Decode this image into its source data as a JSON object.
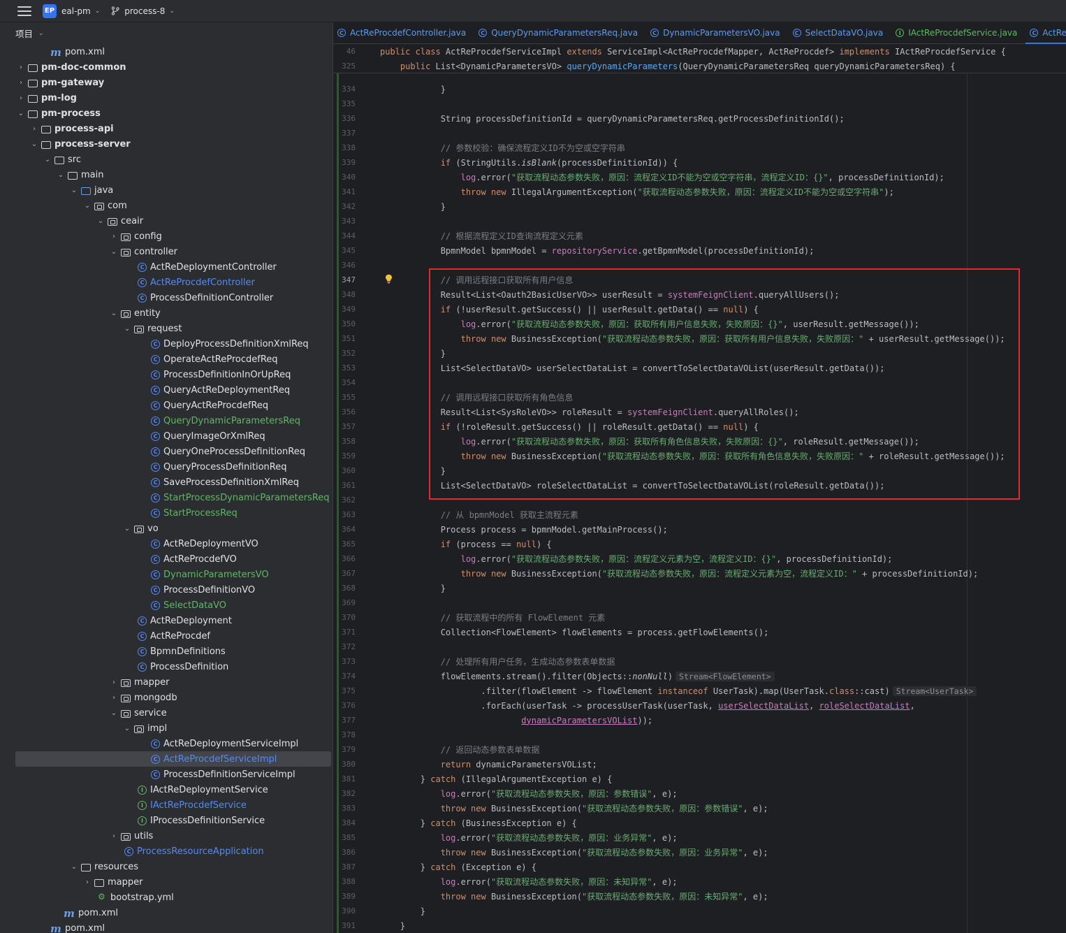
{
  "topbar": {
    "badge": "EP",
    "project_name": "eal-pm",
    "branch": "process-8"
  },
  "project_panel": {
    "title": "项目",
    "tree": [
      {
        "label": "pom.xml",
        "kind": "maven",
        "indent": 62,
        "arrow": "",
        "style": "white"
      },
      {
        "label": "pm-doc-common",
        "kind": "module",
        "indent": 30,
        "arrow": "›",
        "style": "bold"
      },
      {
        "label": "pm-gateway",
        "kind": "module",
        "indent": 30,
        "arrow": "›",
        "style": "bold"
      },
      {
        "label": "pm-log",
        "kind": "module",
        "indent": 30,
        "arrow": "›",
        "style": "bold"
      },
      {
        "label": "pm-process",
        "kind": "module",
        "indent": 30,
        "arrow": "⌄",
        "style": "bold"
      },
      {
        "label": "process-api",
        "kind": "module",
        "indent": 49,
        "arrow": "›",
        "style": "bold"
      },
      {
        "label": "process-server",
        "kind": "module",
        "indent": 49,
        "arrow": "⌄",
        "style": "bold"
      },
      {
        "label": "src",
        "kind": "folder",
        "indent": 68,
        "arrow": "⌄",
        "style": "white"
      },
      {
        "label": "main",
        "kind": "folder",
        "indent": 87,
        "arrow": "⌄",
        "style": "white"
      },
      {
        "label": "java",
        "kind": "src",
        "indent": 106,
        "arrow": "⌄",
        "style": "white"
      },
      {
        "label": "com",
        "kind": "pkg",
        "indent": 125,
        "arrow": "⌄",
        "style": "white"
      },
      {
        "label": "ceair",
        "kind": "pkg",
        "indent": 144,
        "arrow": "⌄",
        "style": "white"
      },
      {
        "label": "config",
        "kind": "pkg",
        "indent": 163,
        "arrow": "›",
        "style": "white"
      },
      {
        "label": "controller",
        "kind": "pkg",
        "indent": 163,
        "arrow": "⌄",
        "style": "white"
      },
      {
        "label": "ActReDeploymentController",
        "kind": "class",
        "indent": 187,
        "arrow": "",
        "style": "white"
      },
      {
        "label": "ActReProcdefController",
        "kind": "class",
        "indent": 187,
        "arrow": "",
        "style": "blue"
      },
      {
        "label": "ProcessDefinitionController",
        "kind": "class",
        "indent": 187,
        "arrow": "",
        "style": "white"
      },
      {
        "label": "entity",
        "kind": "pkg",
        "indent": 163,
        "arrow": "⌄",
        "style": "white"
      },
      {
        "label": "request",
        "kind": "pkg",
        "indent": 182,
        "arrow": "⌄",
        "style": "white"
      },
      {
        "label": "DeployProcessDefinitionXmlReq",
        "kind": "class",
        "indent": 206,
        "arrow": "",
        "style": "white"
      },
      {
        "label": "OperateActReProcdefReq",
        "kind": "class",
        "indent": 206,
        "arrow": "",
        "style": "white"
      },
      {
        "label": "ProcessDefinitionInOrUpReq",
        "kind": "class",
        "indent": 206,
        "arrow": "",
        "style": "white"
      },
      {
        "label": "QueryActReDeploymentReq",
        "kind": "class",
        "indent": 206,
        "arrow": "",
        "style": "white"
      },
      {
        "label": "QueryActReProcdefReq",
        "kind": "class",
        "indent": 206,
        "arrow": "",
        "style": "white"
      },
      {
        "label": "QueryDynamicParametersReq",
        "kind": "class",
        "indent": 206,
        "arrow": "",
        "style": "green"
      },
      {
        "label": "QueryImageOrXmlReq",
        "kind": "class",
        "indent": 206,
        "arrow": "",
        "style": "white"
      },
      {
        "label": "QueryOneProcessDefinitionReq",
        "kind": "class",
        "indent": 206,
        "arrow": "",
        "style": "white"
      },
      {
        "label": "QueryProcessDefinitionReq",
        "kind": "class",
        "indent": 206,
        "arrow": "",
        "style": "white"
      },
      {
        "label": "SaveProcessDefinitionXmlReq",
        "kind": "class",
        "indent": 206,
        "arrow": "",
        "style": "white"
      },
      {
        "label": "StartProcessDynamicParametersReq",
        "kind": "class",
        "indent": 206,
        "arrow": "",
        "style": "green"
      },
      {
        "label": "StartProcessReq",
        "kind": "class",
        "indent": 206,
        "arrow": "",
        "style": "green"
      },
      {
        "label": "vo",
        "kind": "pkg",
        "indent": 182,
        "arrow": "⌄",
        "style": "white"
      },
      {
        "label": "ActReDeploymentVO",
        "kind": "class",
        "indent": 206,
        "arrow": "",
        "style": "white"
      },
      {
        "label": "ActReProcdefVO",
        "kind": "class",
        "indent": 206,
        "arrow": "",
        "style": "white"
      },
      {
        "label": "DynamicParametersVO",
        "kind": "class",
        "indent": 206,
        "arrow": "",
        "style": "green"
      },
      {
        "label": "ProcessDefinitionVO",
        "kind": "class",
        "indent": 206,
        "arrow": "",
        "style": "white"
      },
      {
        "label": "SelectDataVO",
        "kind": "class",
        "indent": 206,
        "arrow": "",
        "style": "green"
      },
      {
        "label": "ActReDeployment",
        "kind": "class",
        "indent": 187,
        "arrow": "",
        "style": "white"
      },
      {
        "label": "ActReProcdef",
        "kind": "class",
        "indent": 187,
        "arrow": "",
        "style": "white"
      },
      {
        "label": "BpmnDefinitions",
        "kind": "class",
        "indent": 187,
        "arrow": "",
        "style": "white"
      },
      {
        "label": "ProcessDefinition",
        "kind": "class",
        "indent": 187,
        "arrow": "",
        "style": "white"
      },
      {
        "label": "mapper",
        "kind": "pkg",
        "indent": 163,
        "arrow": "›",
        "style": "white"
      },
      {
        "label": "mongodb",
        "kind": "pkg",
        "indent": 163,
        "arrow": "›",
        "style": "white"
      },
      {
        "label": "service",
        "kind": "pkg",
        "indent": 163,
        "arrow": "⌄",
        "style": "white"
      },
      {
        "label": "impl",
        "kind": "pkg",
        "indent": 182,
        "arrow": "⌄",
        "style": "white"
      },
      {
        "label": "ActReDeploymentServiceImpl",
        "kind": "class",
        "indent": 206,
        "arrow": "",
        "style": "white"
      },
      {
        "label": "ActReProcdefServiceImpl",
        "kind": "class",
        "indent": 206,
        "arrow": "",
        "style": "blue",
        "selected": true
      },
      {
        "label": "ProcessDefinitionServiceImpl",
        "kind": "class",
        "indent": 206,
        "arrow": "",
        "style": "white"
      },
      {
        "label": "IActReDeploymentService",
        "kind": "intf",
        "indent": 187,
        "arrow": "",
        "style": "white"
      },
      {
        "label": "IActReProcdefService",
        "kind": "intf",
        "indent": 187,
        "arrow": "",
        "style": "blue"
      },
      {
        "label": "IProcessDefinitionService",
        "kind": "intf",
        "indent": 187,
        "arrow": "",
        "style": "white"
      },
      {
        "label": "utils",
        "kind": "pkg",
        "indent": 163,
        "arrow": "›",
        "style": "white"
      },
      {
        "label": "ProcessResourceApplication",
        "kind": "class",
        "indent": 168,
        "arrow": "",
        "style": "blue"
      },
      {
        "label": "resources",
        "kind": "folder",
        "indent": 106,
        "arrow": "⌄",
        "style": "white"
      },
      {
        "label": "mapper",
        "kind": "folder",
        "indent": 125,
        "arrow": "›",
        "style": "white"
      },
      {
        "label": "bootstrap.yml",
        "kind": "yml",
        "indent": 130,
        "arrow": "",
        "style": "white"
      },
      {
        "label": "pom.xml",
        "kind": "maven",
        "indent": 81,
        "arrow": "",
        "style": "white"
      },
      {
        "label": "pom.xml",
        "kind": "maven",
        "indent": 62,
        "arrow": "",
        "style": "white"
      }
    ]
  },
  "tabs": [
    {
      "label": "ActReProcdefController.java",
      "kind": "class",
      "active": false
    },
    {
      "label": "QueryDynamicParametersReq.java",
      "kind": "class",
      "active": false
    },
    {
      "label": "DynamicParametersVO.java",
      "kind": "class",
      "active": false
    },
    {
      "label": "SelectDataVO.java",
      "kind": "class",
      "active": false
    },
    {
      "label": "IActReProcdefService.java",
      "kind": "intf",
      "active": false
    },
    {
      "label": "ActReProcdefServi",
      "kind": "class",
      "active": true
    }
  ],
  "sticky_lines": [
    {
      "num": "46",
      "html": "<span class=\"kw\">public class</span> ActReProcdefServiceImpl <span class=\"kw\">extends</span> ServiceImpl&lt;ActReProcdefMapper, ActReProcdef&gt; <span class=\"kw\">implements</span> IActReProcdefService {"
    },
    {
      "num": "325",
      "html": "    <span class=\"kw\">public</span> List&lt;DynamicParametersVO&gt; <span class=\"fn\">queryDynamicParameters</span>(QueryDynamicParametersReq queryDynamicParametersReq) {"
    }
  ],
  "code_lines": [
    {
      "num": "334",
      "html": "            }"
    },
    {
      "num": "335",
      "html": ""
    },
    {
      "num": "336",
      "html": "            String processDefinitionId = queryDynamicParametersReq.getProcessDefinitionId();"
    },
    {
      "num": "337",
      "html": ""
    },
    {
      "num": "338",
      "html": "            <span class=\"cm\">// 参数校验：确保流程定义ID不为空或空字符串</span>"
    },
    {
      "num": "339",
      "html": "            <span class=\"kw\">if</span> (StringUtils.<span class=\"ital\">isBlank</span>(processDefinitionId)) {"
    },
    {
      "num": "340",
      "html": "                <span class=\"fld\">log</span>.error(<span class=\"st\">\"获取流程动态参数失败，原因：流程定义ID不能为空或空字符串，流程定义ID：{}\"</span>, processDefinitionId);"
    },
    {
      "num": "341",
      "html": "                <span class=\"kw\">throw new</span> IllegalArgumentException(<span class=\"st\">\"获取流程动态参数失败，原因：流程定义ID不能为空或空字符串\"</span>);"
    },
    {
      "num": "342",
      "html": "            }"
    },
    {
      "num": "343",
      "html": ""
    },
    {
      "num": "344",
      "html": "            <span class=\"cm\">// 根据流程定义ID查询流程定义元素</span>"
    },
    {
      "num": "345",
      "html": "            BpmnModel bpmnModel = <span class=\"fld\">repositoryService</span>.getBpmnModel(processDefinitionId);"
    },
    {
      "num": "346",
      "html": ""
    },
    {
      "num": "347",
      "html": "            <span class=\"cm\">// 调用远程接口获取所有用户信息</span>",
      "current": true
    },
    {
      "num": "348",
      "html": "            Result&lt;List&lt;Oauth2BasicUserVO&gt;&gt; userResult = <span class=\"fld\">systemFeignClient</span>.queryAllUsers();"
    },
    {
      "num": "349",
      "html": "            <span class=\"kw\">if</span> (!userResult.getSuccess() || userResult.getData() == <span class=\"kw\">null</span>) {"
    },
    {
      "num": "350",
      "html": "                <span class=\"fld\">log</span>.error(<span class=\"st\">\"获取流程动态参数失败，原因：获取所有用户信息失败，失败原因：{}\"</span>, userResult.getMessage());"
    },
    {
      "num": "351",
      "html": "                <span class=\"kw\">throw new</span> BusinessException(<span class=\"st\">\"获取流程动态参数失败，原因：获取所有用户信息失败，失败原因：\"</span> + userResult.getMessage());"
    },
    {
      "num": "352",
      "html": "            }"
    },
    {
      "num": "353",
      "html": "            List&lt;SelectDataVO&gt; userSelectDataList = convertToSelectDataVOList(userResult.getData());"
    },
    {
      "num": "354",
      "html": ""
    },
    {
      "num": "355",
      "html": "            <span class=\"cm\">// 调用远程接口获取所有角色信息</span>"
    },
    {
      "num": "356",
      "html": "            Result&lt;List&lt;SysRoleVO&gt;&gt; roleResult = <span class=\"fld\">systemFeignClient</span>.queryAllRoles();"
    },
    {
      "num": "357",
      "html": "            <span class=\"kw\">if</span> (!roleResult.getSuccess() || roleResult.getData() == <span class=\"kw\">null</span>) {"
    },
    {
      "num": "358",
      "html": "                <span class=\"fld\">log</span>.error(<span class=\"st\">\"获取流程动态参数失败，原因：获取所有角色信息失败，失败原因：{}\"</span>, roleResult.getMessage());"
    },
    {
      "num": "359",
      "html": "                <span class=\"kw\">throw new</span> BusinessException(<span class=\"st\">\"获取流程动态参数失败，原因：获取所有角色信息失败，失败原因：\"</span> + roleResult.getMessage());"
    },
    {
      "num": "360",
      "html": "            }"
    },
    {
      "num": "361",
      "html": "            List&lt;SelectDataVO&gt; roleSelectDataList = convertToSelectDataVOList(roleResult.getData());"
    },
    {
      "num": "362",
      "html": ""
    },
    {
      "num": "363",
      "html": "            <span class=\"cm\">// 从 bpmnModel 获取主流程元素</span>"
    },
    {
      "num": "364",
      "html": "            Process process = bpmnModel.getMainProcess();"
    },
    {
      "num": "365",
      "html": "            <span class=\"kw\">if</span> (process == <span class=\"kw\">null</span>) {"
    },
    {
      "num": "366",
      "html": "                <span class=\"fld\">log</span>.error(<span class=\"st\">\"获取流程动态参数失败，原因：流程定义元素为空，流程定义ID：{}\"</span>, processDefinitionId);"
    },
    {
      "num": "367",
      "html": "                <span class=\"kw\">throw new</span> BusinessException(<span class=\"st\">\"获取流程动态参数失败，原因：流程定义元素为空，流程定义ID：\"</span> + processDefinitionId);"
    },
    {
      "num": "368",
      "html": "            }"
    },
    {
      "num": "369",
      "html": ""
    },
    {
      "num": "370",
      "html": "            <span class=\"cm\">// 获取流程中的所有 FlowElement 元素</span>"
    },
    {
      "num": "371",
      "html": "            Collection&lt;FlowElement&gt; flowElements = process.getFlowElements();"
    },
    {
      "num": "372",
      "html": ""
    },
    {
      "num": "373",
      "html": "            <span class=\"cm\">// 处理所有用户任务，生成动态参数表单数据</span>"
    },
    {
      "num": "374",
      "html": "            flowElements.stream().filter(Objects::<span class=\"ital\">nonNull</span>)<span class=\"hint\">Stream&lt;FlowElement&gt;</span>"
    },
    {
      "num": "375",
      "html": "                    .filter(flowElement -&gt; flowElement <span class=\"kw\">instanceof</span> UserTask).map(UserTask.<span class=\"kw\">class</span>::cast)<span class=\"hint\">Stream&lt;UserTask&gt;</span>"
    },
    {
      "num": "376",
      "html": "                    .forEach(userTask -&gt; processUserTask(userTask, <span class=\"ul\">userSelectDataList</span>, <span class=\"ul\">roleSelectDataList</span>,"
    },
    {
      "num": "377",
      "html": "                            <span class=\"ul\">dynamicParametersVOList</span>));"
    },
    {
      "num": "378",
      "html": ""
    },
    {
      "num": "379",
      "html": "            <span class=\"cm\">// 返回动态参数表单数据</span>"
    },
    {
      "num": "380",
      "html": "            <span class=\"kw\">return</span> dynamicParametersVOList;"
    },
    {
      "num": "381",
      "html": "        } <span class=\"kw\">catch</span> (IllegalArgumentException e) {"
    },
    {
      "num": "382",
      "html": "            <span class=\"fld\">log</span>.error(<span class=\"st\">\"获取流程动态参数失败，原因：参数错误\"</span>, e);"
    },
    {
      "num": "383",
      "html": "            <span class=\"kw\">throw new</span> BusinessException(<span class=\"st\">\"获取流程动态参数失败，原因：参数错误\"</span>, e);"
    },
    {
      "num": "384",
      "html": "        } <span class=\"kw\">catch</span> (BusinessException e) {"
    },
    {
      "num": "385",
      "html": "            <span class=\"fld\">log</span>.error(<span class=\"st\">\"获取流程动态参数失败，原因：业务异常\"</span>, e);"
    },
    {
      "num": "386",
      "html": "            <span class=\"kw\">throw new</span> BusinessException(<span class=\"st\">\"获取流程动态参数失败，原因：业务异常\"</span>, e);"
    },
    {
      "num": "387",
      "html": "        } <span class=\"kw\">catch</span> (Exception e) {"
    },
    {
      "num": "388",
      "html": "            <span class=\"fld\">log</span>.error(<span class=\"st\">\"获取流程动态参数失败，原因：未知异常\"</span>, e);"
    },
    {
      "num": "389",
      "html": "            <span class=\"kw\">throw new</span> BusinessException(<span class=\"st\">\"获取流程动态参数失败，原因：未知异常\"</span>, e);"
    },
    {
      "num": "390",
      "html": "        }"
    },
    {
      "num": "391",
      "html": "    }"
    }
  ],
  "colors": {
    "keyword": "#cf8e6d",
    "string": "#6aab73",
    "comment": "#7a7e85",
    "field": "#c77dbb",
    "highlight_box": "#e5292f"
  }
}
